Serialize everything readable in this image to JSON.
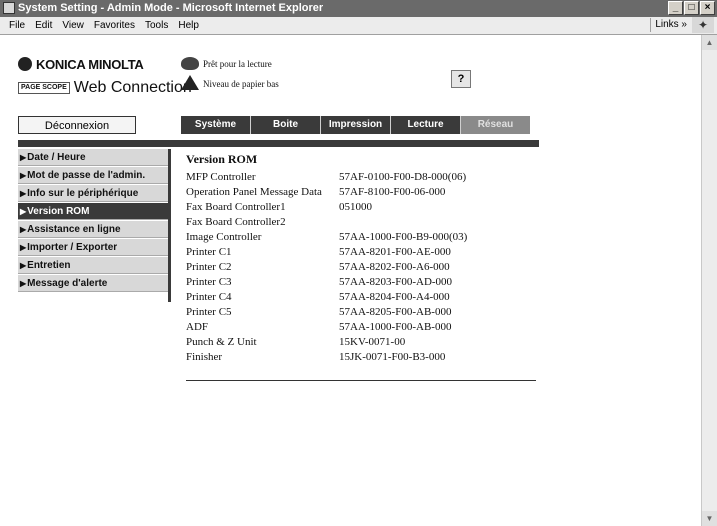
{
  "window": {
    "title": "System Setting - Admin Mode - Microsoft Internet Explorer",
    "controls": [
      "minimize",
      "maximize",
      "close"
    ]
  },
  "menubar": {
    "items": [
      "File",
      "Edit",
      "View",
      "Favorites",
      "Tools",
      "Help"
    ],
    "links_label": "Links »"
  },
  "header": {
    "brand": "KONICA MINOLTA",
    "page_scope": "PAGE SCOPE",
    "product": "Web Connection",
    "status": [
      {
        "text": "Prêt pour la lecture",
        "icon": "printer-icon"
      },
      {
        "text": "Niveau de papier bas",
        "icon": "warning-icon"
      }
    ],
    "help_label": "?"
  },
  "logout_label": "Déconnexion",
  "tabs": [
    "Système",
    "Boite",
    "Impression",
    "Lecture",
    "Réseau"
  ],
  "sidebar": {
    "items": [
      {
        "label": "Date / Heure",
        "active": false
      },
      {
        "label": "Mot de passe de l'admin.",
        "active": false
      },
      {
        "label": "Info sur le périphérique",
        "active": false
      },
      {
        "label": "Version ROM",
        "active": true
      },
      {
        "label": "Assistance en ligne",
        "active": false
      },
      {
        "label": "Importer / Exporter",
        "active": false
      },
      {
        "label": "Entretien",
        "active": false
      },
      {
        "label": "Message d'alerte",
        "active": false
      }
    ]
  },
  "content": {
    "heading": "Version ROM",
    "rows": [
      {
        "label": "MFP Controller",
        "value": "57AF-0100-F00-D8-000(06)"
      },
      {
        "label": "Operation Panel Message Data",
        "value": "57AF-8100-F00-06-000"
      },
      {
        "label": "Fax Board Controller1",
        "value": "051000"
      },
      {
        "label": "Fax Board Controller2",
        "value": ""
      },
      {
        "label": "Image Controller",
        "value": "57AA-1000-F00-B9-000(03)"
      },
      {
        "label": "Printer C1",
        "value": "57AA-8201-F00-AE-000"
      },
      {
        "label": "Printer C2",
        "value": "57AA-8202-F00-A6-000"
      },
      {
        "label": "Printer C3",
        "value": "57AA-8203-F00-AD-000"
      },
      {
        "label": "Printer C4",
        "value": "57AA-8204-F00-A4-000"
      },
      {
        "label": "Printer C5",
        "value": "57AA-8205-F00-AB-000"
      },
      {
        "label": "ADF",
        "value": "57AA-1000-F00-AB-000"
      },
      {
        "label": "Punch & Z Unit",
        "value": "15KV-0071-00"
      },
      {
        "label": "Finisher",
        "value": "15JK-0071-F00-B3-000"
      }
    ]
  }
}
